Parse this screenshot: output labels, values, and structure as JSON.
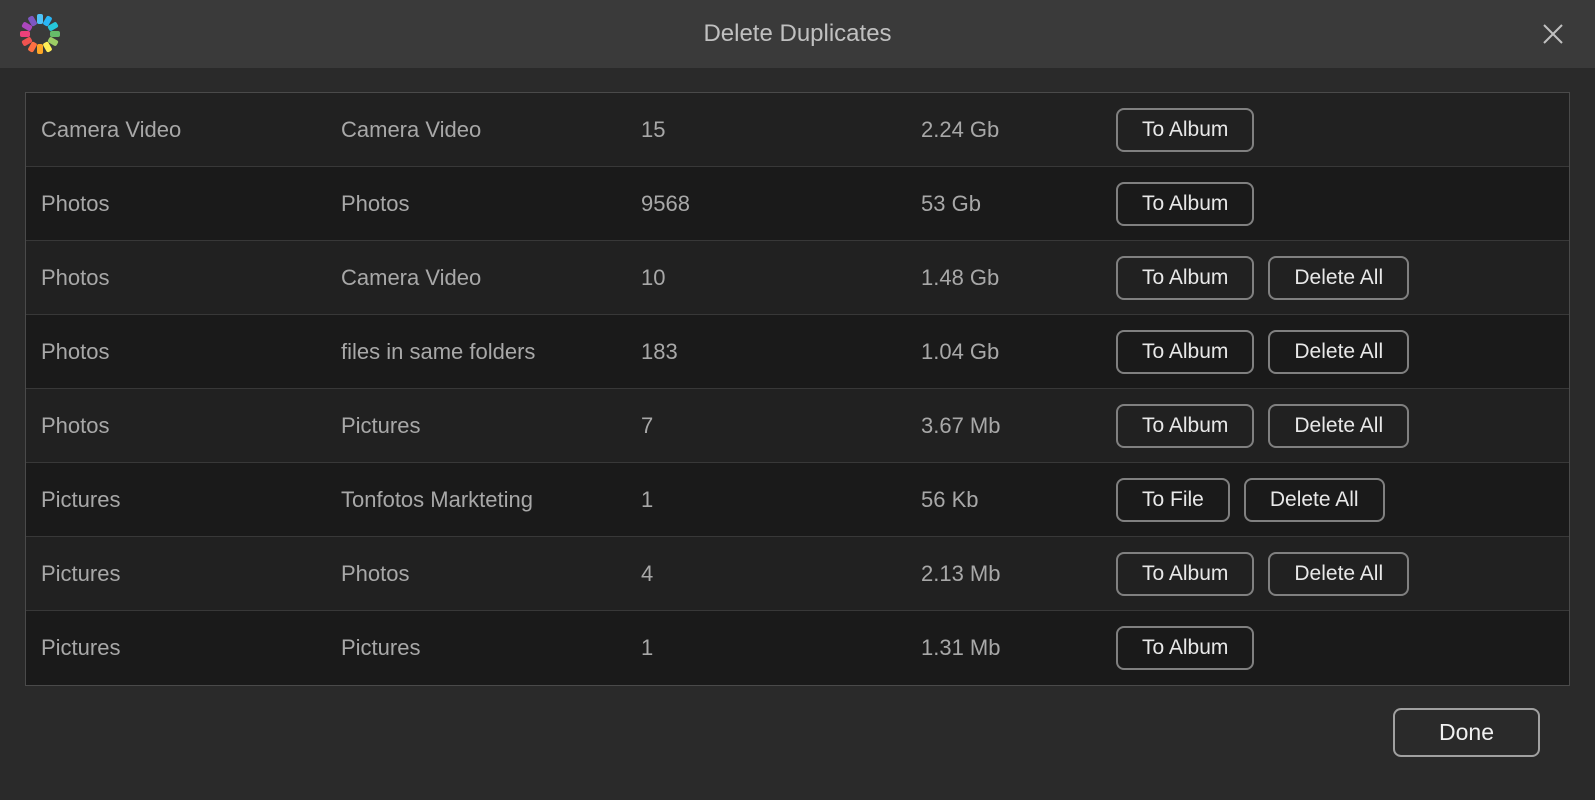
{
  "header": {
    "title": "Delete Duplicates"
  },
  "rows": [
    {
      "col1": "Camera Video",
      "col2": "Camera Video",
      "count": "15",
      "size": "2.24 Gb",
      "primary": "To Album",
      "secondary": null
    },
    {
      "col1": "Photos",
      "col2": "Photos",
      "count": "9568",
      "size": "53 Gb",
      "primary": "To Album",
      "secondary": null
    },
    {
      "col1": "Photos",
      "col2": "Camera Video",
      "count": "10",
      "size": "1.48 Gb",
      "primary": "To Album",
      "secondary": "Delete All"
    },
    {
      "col1": "Photos",
      "col2": "files in same folders",
      "count": "183",
      "size": "1.04 Gb",
      "primary": "To Album",
      "secondary": "Delete All"
    },
    {
      "col1": "Photos",
      "col2": "Pictures",
      "count": "7",
      "size": "3.67 Mb",
      "primary": "To Album",
      "secondary": "Delete All"
    },
    {
      "col1": "Pictures",
      "col2": "Tonfotos Markteting",
      "count": "1",
      "size": "56 Kb",
      "primary": "To File",
      "secondary": "Delete All"
    },
    {
      "col1": "Pictures",
      "col2": "Photos",
      "count": "4",
      "size": "2.13 Mb",
      "primary": "To Album",
      "secondary": "Delete All"
    },
    {
      "col1": "Pictures",
      "col2": "Pictures",
      "count": "1",
      "size": "1.31 Mb",
      "primary": "To Album",
      "secondary": null
    }
  ],
  "footer": {
    "done_label": "Done"
  }
}
